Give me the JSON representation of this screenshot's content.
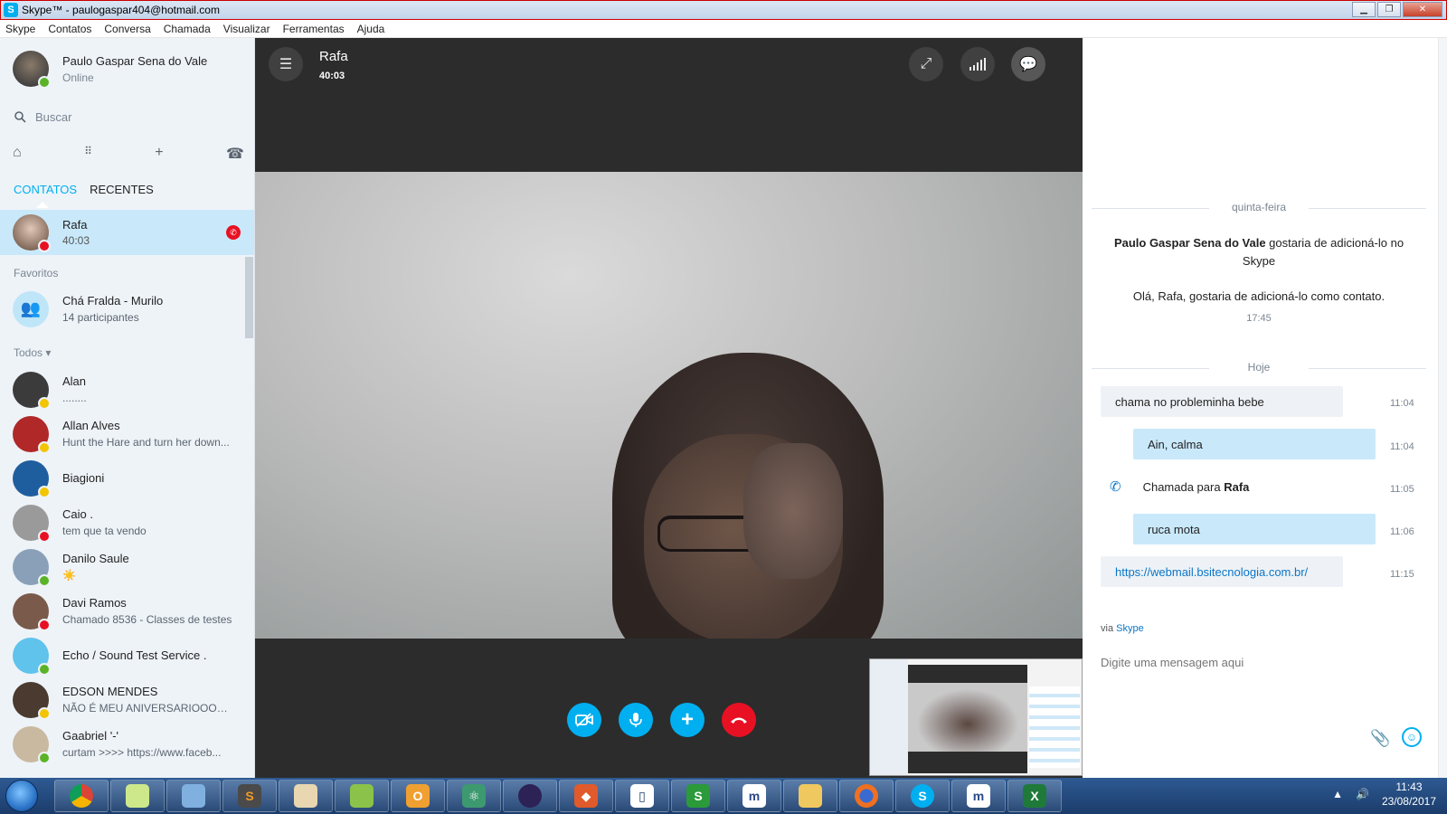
{
  "window": {
    "title": "Skype™ - paulogaspar404@hotmail.com",
    "app_icon": "S"
  },
  "menu": [
    "Skype",
    "Contatos",
    "Conversa",
    "Chamada",
    "Visualizar",
    "Ferramentas",
    "Ajuda"
  ],
  "profile": {
    "name": "Paulo Gaspar Sena do Vale",
    "status": "Online"
  },
  "search": {
    "placeholder": "Buscar"
  },
  "tabs": {
    "contacts": "CONTATOS",
    "recents": "RECENTES"
  },
  "active_call_contact": {
    "name": "Rafa",
    "timer": "40:03"
  },
  "sections": {
    "favorites": "Favoritos",
    "all": "Todos"
  },
  "favorites": [
    {
      "name": "Chá Fralda - Murilo",
      "sub": "14 participantes"
    }
  ],
  "contacts": [
    {
      "name": "Alan",
      "sub": "........",
      "status": "away",
      "color": "#3b3b3b"
    },
    {
      "name": "Allan Alves",
      "sub": "Hunt the Hare and turn her down...",
      "status": "away",
      "color": "#b02828"
    },
    {
      "name": "Biagioni",
      "sub": "",
      "status": "away",
      "color": "#1f5e9e"
    },
    {
      "name": "Caio .",
      "sub": "tem que ta vendo",
      "status": "busy",
      "color": "#9a9a9a"
    },
    {
      "name": "Danilo Saule",
      "sub": "☀️",
      "status": "online",
      "color": "#8aa0b8"
    },
    {
      "name": "Davi Ramos",
      "sub": "Chamado 8536 - Classes de testes",
      "status": "busy",
      "color": "#7a5a4a"
    },
    {
      "name": "Echo / Sound Test Service .",
      "sub": "",
      "status": "online",
      "color": "#5fc3ec"
    },
    {
      "name": "EDSON MENDES",
      "sub": "NÃO É MEU ANIVERSARIOOOO...",
      "status": "away",
      "color": "#4a3a30"
    },
    {
      "name": "Gaabriel '-'",
      "sub": "curtam >>>> https://www.faceb...",
      "status": "online",
      "color": "#c9b9a0"
    }
  ],
  "call": {
    "name": "Rafa",
    "timer": "40:03",
    "icons": {
      "menu": "list-icon",
      "fullscreen": "expand-icon",
      "quality": "signal-icon",
      "chat": "chat-bubble-icon",
      "video": "video-off-icon",
      "mic": "microphone-icon",
      "add": "plus-icon",
      "hangup": "hangup-icon"
    }
  },
  "chat": {
    "day1": "quinta-feira",
    "request_sender": "Paulo Gaspar Sena do Vale",
    "request_text": " gostaria de adicioná-lo no Skype",
    "greeting": "Olá, Rafa, gostaria de adicioná-lo como contato.",
    "greeting_time": "17:45",
    "day2": "Hoje",
    "messages": [
      {
        "text": "chama no probleminha bebe",
        "time": "11:04",
        "dir": "in"
      },
      {
        "text": "Ain, calma",
        "time": "11:04",
        "dir": "out"
      },
      {
        "text_prefix": "Chamada para ",
        "text_bold": "Rafa",
        "time": "11:05",
        "dir": "call"
      },
      {
        "text": "ruca mota",
        "time": "11:06",
        "dir": "out"
      },
      {
        "text": "https://webmail.bsitecnologia.com.br/",
        "time": "11:15",
        "dir": "link"
      }
    ],
    "via_label": "via ",
    "via_brand": "Skype",
    "compose_placeholder": "Digite uma mensagem aqui"
  },
  "taskbar": {
    "apps": [
      "Chrome",
      "Notepad",
      "Explorer",
      "Sublime",
      "Paint",
      "Android Studio",
      "Outlook",
      "Atom",
      "Eclipse",
      "Git",
      "Frame",
      "Sigma",
      "Meebo",
      "Folder",
      "Firefox",
      "Skype",
      "Meebo",
      "Excel"
    ],
    "time": "11:43",
    "date": "23/08/2017"
  },
  "colors": {
    "accent": "#00aff0",
    "hangup": "#e81123",
    "online": "#5ab327",
    "away": "#f3c400",
    "busy": "#e81123"
  }
}
